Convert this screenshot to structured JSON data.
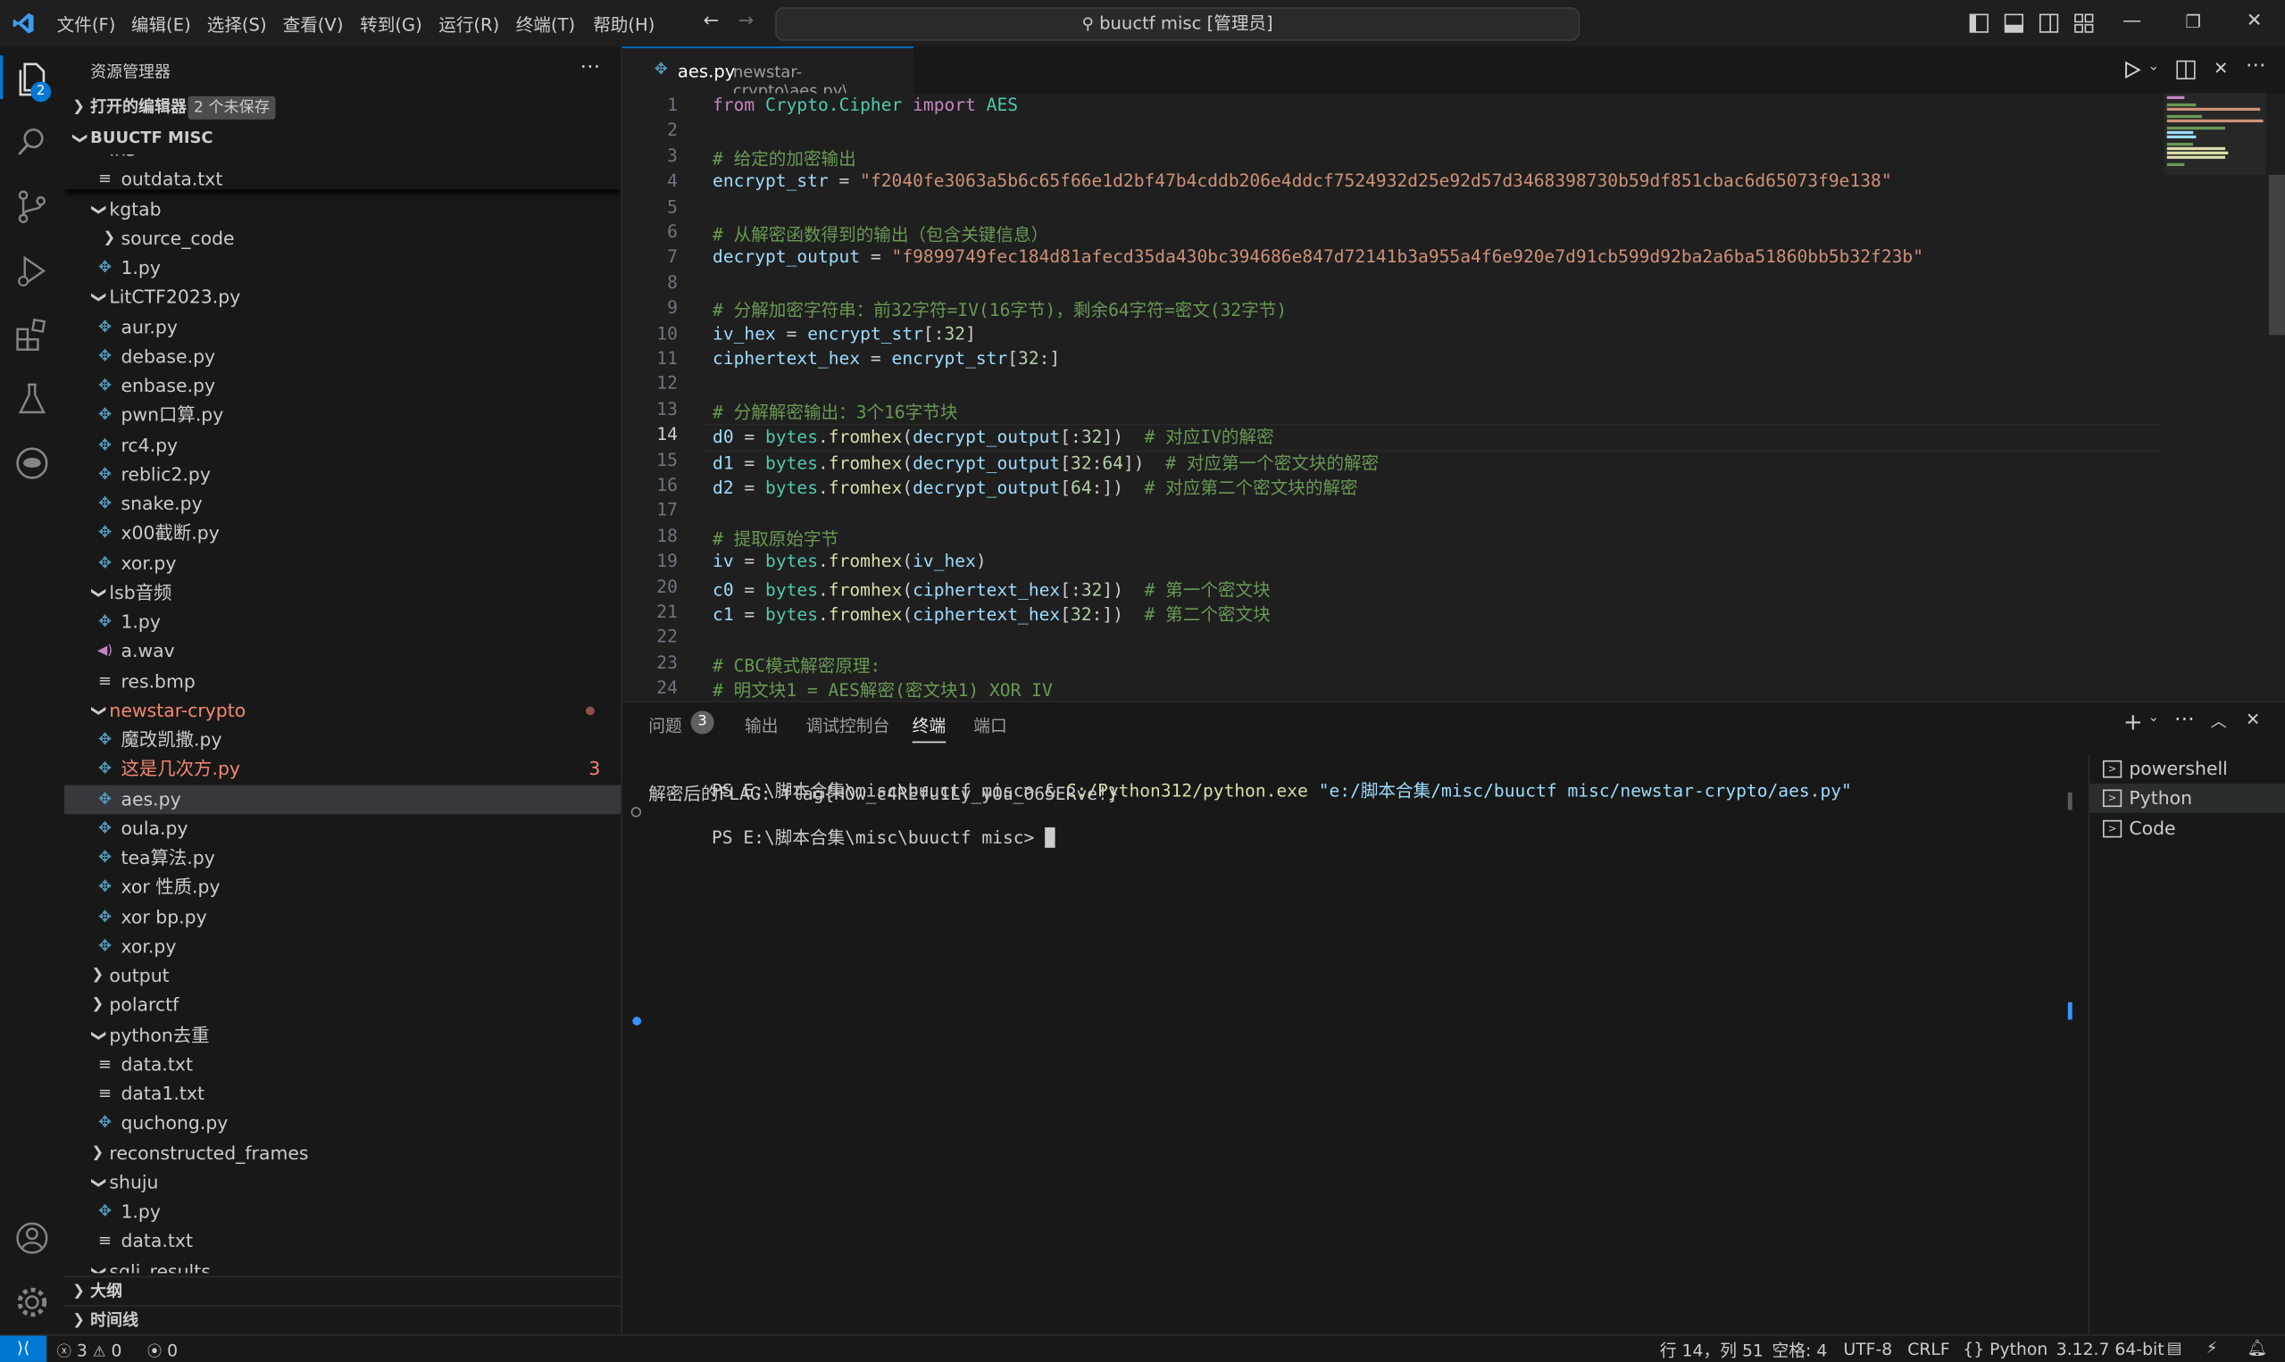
{
  "titlebar": {
    "menus": [
      "文件(F)",
      "编辑(E)",
      "选择(S)",
      "查看(V)",
      "转到(G)",
      "运行(R)",
      "终端(T)",
      "帮助(H)"
    ],
    "search": "buuctf misc [管理员]"
  },
  "activity": {
    "explorer_badge": "2"
  },
  "sidebar": {
    "header": "资源管理器",
    "open_editors": "打开的编辑器",
    "unsaved_badge": "2 个未保存",
    "workspace": "BUUCTF MISC",
    "tree": [
      {
        "label": "ins",
        "indent": 1,
        "type": "folder-open"
      },
      {
        "label": "outdata.txt",
        "indent": 2,
        "type": "file-txt"
      },
      {
        "label": "kgtab",
        "indent": 1,
        "type": "folder-open"
      },
      {
        "label": "source_code",
        "indent": 2,
        "type": "folder-closed"
      },
      {
        "label": "1.py",
        "indent": 2,
        "type": "file-py"
      },
      {
        "label": "LitCTF2023.py",
        "indent": 1,
        "type": "folder-open"
      },
      {
        "label": "aur.py",
        "indent": 2,
        "type": "file-py"
      },
      {
        "label": "debase.py",
        "indent": 2,
        "type": "file-py"
      },
      {
        "label": "enbase.py",
        "indent": 2,
        "type": "file-py"
      },
      {
        "label": "pwn口算.py",
        "indent": 2,
        "type": "file-py"
      },
      {
        "label": "rc4.py",
        "indent": 2,
        "type": "file-py"
      },
      {
        "label": "reblic2.py",
        "indent": 2,
        "type": "file-py"
      },
      {
        "label": "snake.py",
        "indent": 2,
        "type": "file-py"
      },
      {
        "label": "x00截断.py",
        "indent": 2,
        "type": "file-py"
      },
      {
        "label": "xor.py",
        "indent": 2,
        "type": "file-py"
      },
      {
        "label": "lsb音频",
        "indent": 1,
        "type": "folder-open"
      },
      {
        "label": "1.py",
        "indent": 2,
        "type": "file-py"
      },
      {
        "label": "a.wav",
        "indent": 2,
        "type": "file-audio"
      },
      {
        "label": "res.bmp",
        "indent": 2,
        "type": "file-txt"
      },
      {
        "label": "newstar-crypto",
        "indent": 1,
        "type": "folder-open",
        "status": "error-dot"
      },
      {
        "label": "魔改凯撒.py",
        "indent": 2,
        "type": "file-py"
      },
      {
        "label": "这是几次方.py",
        "indent": 2,
        "type": "file-py",
        "status": "error",
        "count": "3"
      },
      {
        "label": "aes.py",
        "indent": 2,
        "type": "file-py",
        "active": true
      },
      {
        "label": "oula.py",
        "indent": 2,
        "type": "file-py"
      },
      {
        "label": "tea算法.py",
        "indent": 2,
        "type": "file-py"
      },
      {
        "label": "xor 性质.py",
        "indent": 2,
        "type": "file-py"
      },
      {
        "label": "xor bp.py",
        "indent": 2,
        "type": "file-py"
      },
      {
        "label": "xor.py",
        "indent": 2,
        "type": "file-py"
      },
      {
        "label": "output",
        "indent": 1,
        "type": "folder-closed"
      },
      {
        "label": "polarctf",
        "indent": 1,
        "type": "folder-closed"
      },
      {
        "label": "python去重",
        "indent": 1,
        "type": "folder-open"
      },
      {
        "label": "data.txt",
        "indent": 2,
        "type": "file-txt"
      },
      {
        "label": "data1.txt",
        "indent": 2,
        "type": "file-txt"
      },
      {
        "label": "quchong.py",
        "indent": 2,
        "type": "file-py"
      },
      {
        "label": "reconstructed_frames",
        "indent": 1,
        "type": "folder-closed"
      },
      {
        "label": "shuju",
        "indent": 1,
        "type": "folder-open"
      },
      {
        "label": "1.py",
        "indent": 2,
        "type": "file-py"
      },
      {
        "label": "data.txt",
        "indent": 2,
        "type": "file-txt"
      },
      {
        "label": "sqli_results",
        "indent": 1,
        "type": "folder-open"
      }
    ],
    "outline": "大纲",
    "timeline": "时间线"
  },
  "editor": {
    "tab_name": "aes.py",
    "tab_path": "newstar-crypto\\aes.py\\...",
    "current_line": 14,
    "lines": [
      [
        [
          "kw",
          "from"
        ],
        [
          "t",
          " "
        ],
        [
          "cls",
          "Crypto.Cipher"
        ],
        [
          "t",
          " "
        ],
        [
          "kw",
          "import"
        ],
        [
          "t",
          " "
        ],
        [
          "cls",
          "AES"
        ]
      ],
      [],
      [
        [
          "cm",
          "# 给定的加密输出"
        ]
      ],
      [
        [
          "var",
          "encrypt_str"
        ],
        [
          "t",
          " = "
        ],
        [
          "str",
          "\"f2040fe3063a5b6c65f66e1d2bf47b4cddb206e4ddcf7524932d25e92d57d3468398730b59df851cbac6d65073f9e138\""
        ]
      ],
      [],
      [
        [
          "cm",
          "# 从解密函数得到的输出（包含关键信息）"
        ]
      ],
      [
        [
          "var",
          "decrypt_output"
        ],
        [
          "t",
          " = "
        ],
        [
          "str",
          "\"f9899749fec184d81afecd35da430bc394686e847d72141b3a955a4f6e920e7d91cb599d92ba2a6ba51860bb5b32f23b\""
        ]
      ],
      [],
      [
        [
          "cm",
          "# 分解加密字符串：前32字符=IV(16字节)，剩余64字符=密文(32字节)"
        ]
      ],
      [
        [
          "var",
          "iv_hex"
        ],
        [
          "t",
          " = "
        ],
        [
          "var",
          "encrypt_str"
        ],
        [
          "t",
          "[:"
        ],
        [
          "num",
          "32"
        ],
        [
          "t",
          "]"
        ]
      ],
      [
        [
          "var",
          "ciphertext_hex"
        ],
        [
          "t",
          " = "
        ],
        [
          "var",
          "encrypt_str"
        ],
        [
          "t",
          "["
        ],
        [
          "num",
          "32"
        ],
        [
          "t",
          ":]"
        ]
      ],
      [],
      [
        [
          "cm",
          "# 分解解密输出：3个16字节块"
        ]
      ],
      [
        [
          "var",
          "d0"
        ],
        [
          "t",
          " = "
        ],
        [
          "cls",
          "bytes"
        ],
        [
          "t",
          "."
        ],
        [
          "fn",
          "fromhex"
        ],
        [
          "t",
          "("
        ],
        [
          "var",
          "decrypt_output"
        ],
        [
          "t",
          "[:"
        ],
        [
          "num",
          "32"
        ],
        [
          "t",
          "])  "
        ],
        [
          "cm",
          "# 对应IV的解密"
        ]
      ],
      [
        [
          "var",
          "d1"
        ],
        [
          "t",
          " = "
        ],
        [
          "cls",
          "bytes"
        ],
        [
          "t",
          "."
        ],
        [
          "fn",
          "fromhex"
        ],
        [
          "t",
          "("
        ],
        [
          "var",
          "decrypt_output"
        ],
        [
          "t",
          "["
        ],
        [
          "num",
          "32"
        ],
        [
          "t",
          ":"
        ],
        [
          "num",
          "64"
        ],
        [
          "t",
          "])  "
        ],
        [
          "cm",
          "# 对应第一个密文块的解密"
        ]
      ],
      [
        [
          "var",
          "d2"
        ],
        [
          "t",
          " = "
        ],
        [
          "cls",
          "bytes"
        ],
        [
          "t",
          "."
        ],
        [
          "fn",
          "fromhex"
        ],
        [
          "t",
          "("
        ],
        [
          "var",
          "decrypt_output"
        ],
        [
          "t",
          "["
        ],
        [
          "num",
          "64"
        ],
        [
          "t",
          ":])  "
        ],
        [
          "cm",
          "# 对应第二个密文块的解密"
        ]
      ],
      [],
      [
        [
          "cm",
          "# 提取原始字节"
        ]
      ],
      [
        [
          "var",
          "iv"
        ],
        [
          "t",
          " = "
        ],
        [
          "cls",
          "bytes"
        ],
        [
          "t",
          "."
        ],
        [
          "fn",
          "fromhex"
        ],
        [
          "t",
          "("
        ],
        [
          "var",
          "iv_hex"
        ],
        [
          "t",
          ")"
        ]
      ],
      [
        [
          "var",
          "c0"
        ],
        [
          "t",
          " = "
        ],
        [
          "cls",
          "bytes"
        ],
        [
          "t",
          "."
        ],
        [
          "fn",
          "fromhex"
        ],
        [
          "t",
          "("
        ],
        [
          "var",
          "ciphertext_hex"
        ],
        [
          "t",
          "[:"
        ],
        [
          "num",
          "32"
        ],
        [
          "t",
          "])  "
        ],
        [
          "cm",
          "# 第一个密文块"
        ]
      ],
      [
        [
          "var",
          "c1"
        ],
        [
          "t",
          " = "
        ],
        [
          "cls",
          "bytes"
        ],
        [
          "t",
          "."
        ],
        [
          "fn",
          "fromhex"
        ],
        [
          "t",
          "("
        ],
        [
          "var",
          "ciphertext_hex"
        ],
        [
          "t",
          "["
        ],
        [
          "num",
          "32"
        ],
        [
          "t",
          ":])  "
        ],
        [
          "cm",
          "# 第二个密文块"
        ]
      ],
      [],
      [
        [
          "cm",
          "# CBC模式解密原理:"
        ]
      ],
      [
        [
          "cm",
          "# 明文块1 = AES解密(密文块1) XOR IV"
        ]
      ]
    ]
  },
  "panel": {
    "tabs": [
      "问题",
      "输出",
      "调试控制台",
      "终端",
      "端口"
    ],
    "problems_count": "3",
    "active_tab": "终端",
    "terminal": {
      "prompt1": "PS E:\\脚本合集\\misc\\buuctf misc> ",
      "amp": "& ",
      "exe": "C:/Python312/python.exe",
      "arg": " \"e:/脚本合集/misc/buuctf misc/newstar-crypto/aes.py\"",
      "output": "解密后的FLAG: flag{HOw_c4REfu1Ly_yOu_O65ERve!}",
      "prompt2": "PS E:\\脚本合集\\misc\\buuctf misc> "
    },
    "terminals": [
      "powershell",
      "Python",
      "Code"
    ],
    "active_terminal": "Python"
  },
  "statusbar": {
    "errors": "3",
    "warnings": "0",
    "ports": "0",
    "position": "行 14，列 51",
    "spaces": "空格: 4",
    "encoding": "UTF-8",
    "eol": "CRLF",
    "language": "Python",
    "interpreter": "3.12.7 64-bit"
  },
  "colors": {
    "accent": "#0078d4",
    "error": "#f14c4c",
    "folder_error": "#f48771",
    "python_icon": "#519aba"
  }
}
